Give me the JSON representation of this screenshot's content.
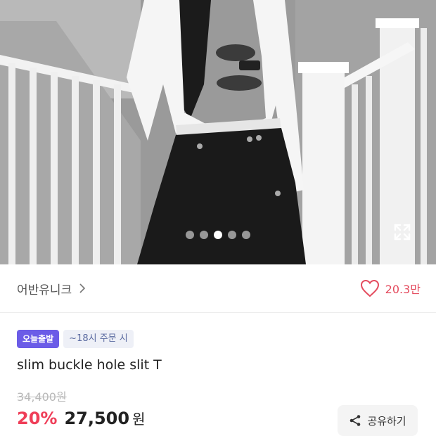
{
  "carousel": {
    "total": 5,
    "active_index": 2
  },
  "brand": {
    "name": "어반유니크",
    "chevron_icon": "chevron-right-icon"
  },
  "like": {
    "count": "20.3만",
    "icon": "heart-outline-icon",
    "color": "#e44b5e"
  },
  "badges": {
    "delivery": "오늘출발",
    "cutoff": "~18시 주문 시"
  },
  "product": {
    "title": "slim buckle hole slit T",
    "original_price": "34,400원",
    "discount": "20%",
    "price": "27,500",
    "currency": "원"
  },
  "share": {
    "label": "공유하기",
    "icon": "share-icon"
  },
  "colors": {
    "discount": "#ef3e58",
    "badge_primary": "#6b5ce7",
    "badge_secondary_bg": "#eef0f7"
  }
}
